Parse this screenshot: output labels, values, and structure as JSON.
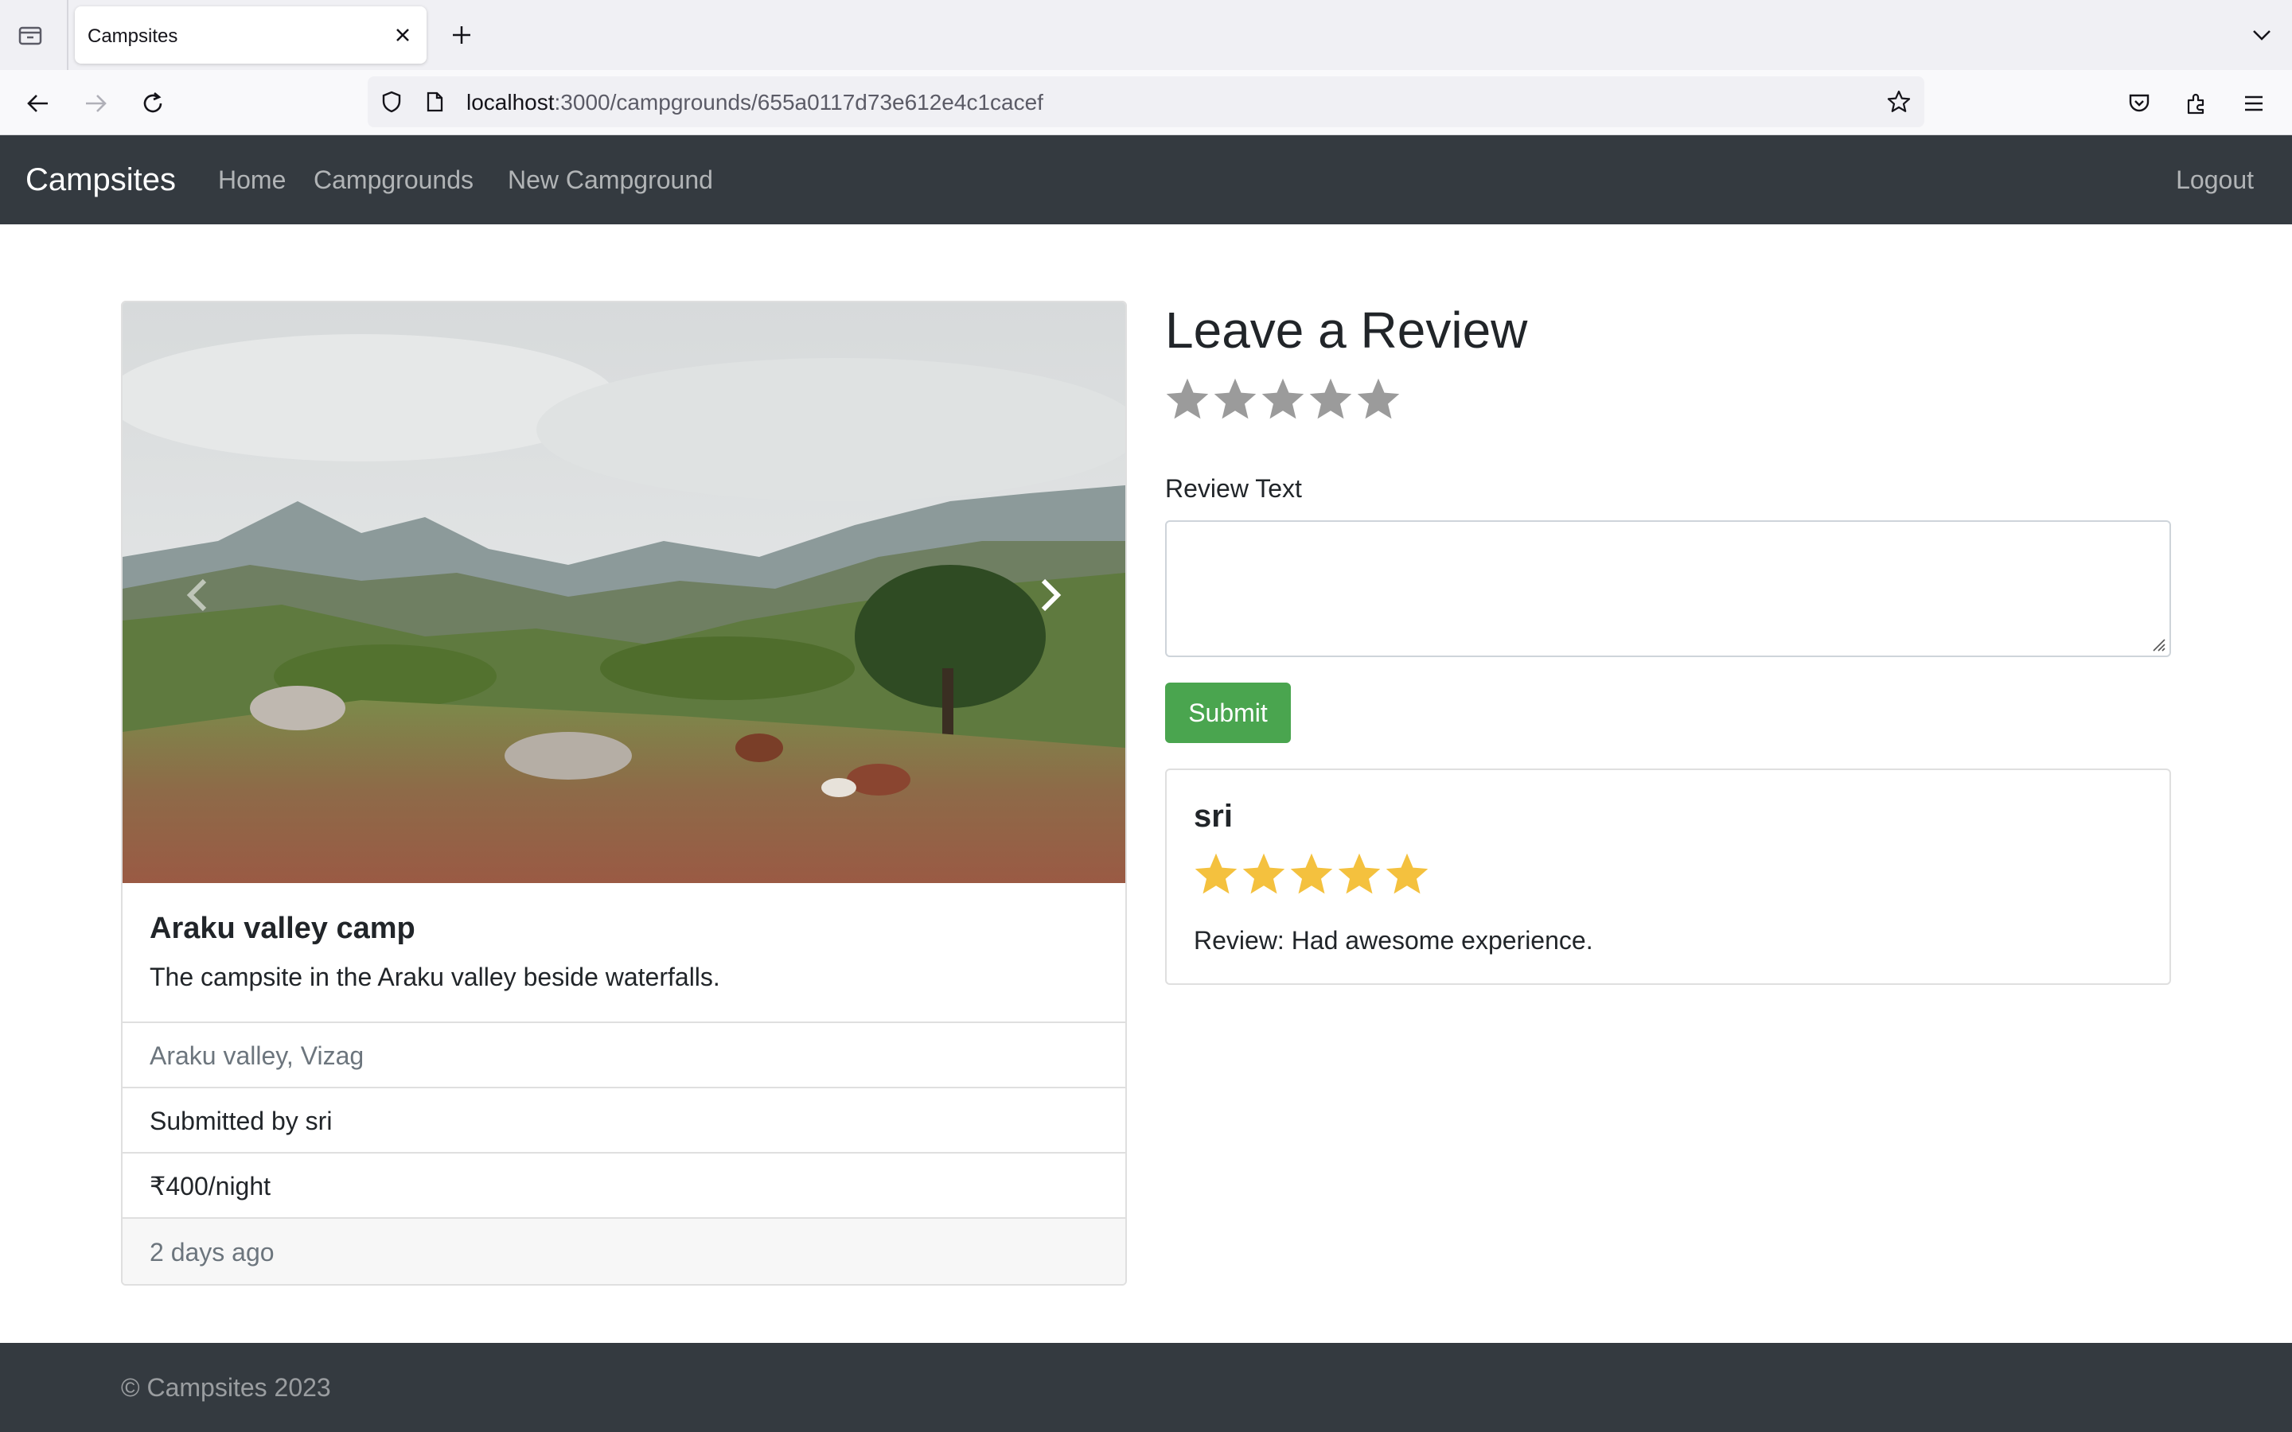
{
  "browser": {
    "tab_title": "Campsites",
    "url_host": "localhost",
    "url_path": ":3000/campgrounds/655a0117d73e612e4c1cacef"
  },
  "navbar": {
    "brand": "Campsites",
    "links": [
      "Home",
      "Campgrounds",
      "New Campground"
    ],
    "logout": "Logout"
  },
  "campground": {
    "title": "Araku valley camp",
    "description": "The campsite in the Araku valley beside waterfalls.",
    "location": "Araku valley, Vizag",
    "submitted_by": "Submitted by sri",
    "price": "₹400/night",
    "posted": "2 days ago"
  },
  "review_form": {
    "heading": "Leave a Review",
    "rating_value": 0,
    "rating_max": 5,
    "label": "Review Text",
    "text_value": "",
    "submit_label": "Submit"
  },
  "reviews": [
    {
      "author": "sri",
      "rating": 5,
      "text": "Review: Had awesome experience."
    }
  ],
  "footer": {
    "text": "© Campsites 2023"
  },
  "colors": {
    "navbar_bg": "#343a40",
    "submit_green": "#4aa54f",
    "star_filled": "#f4c13e",
    "star_empty": "#9b9b9b"
  }
}
